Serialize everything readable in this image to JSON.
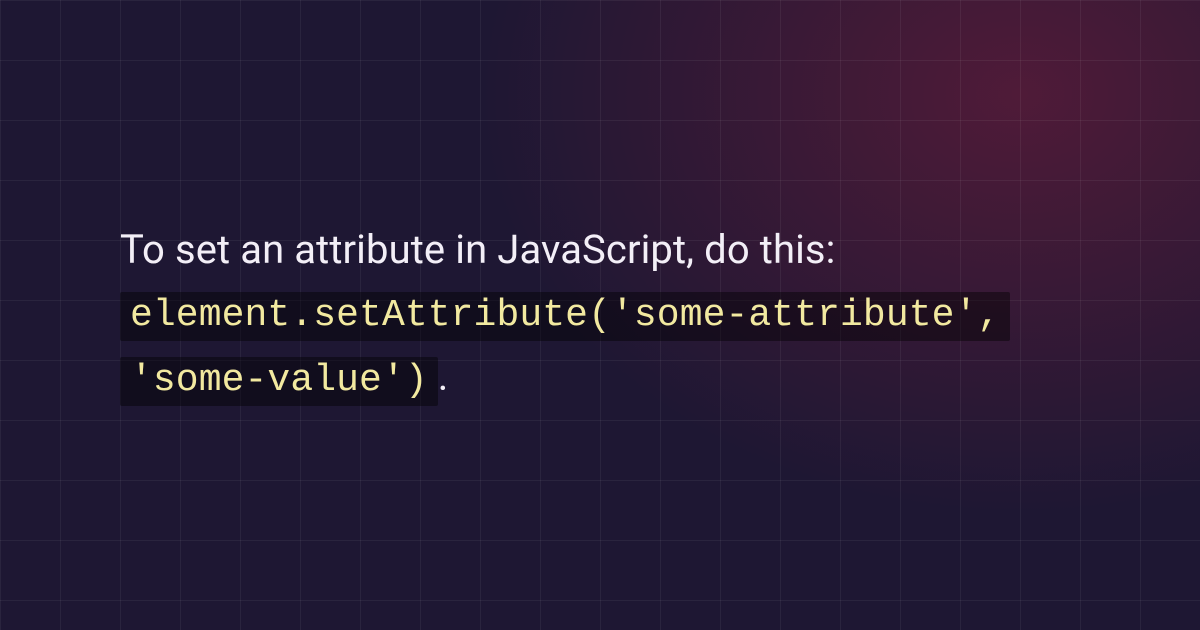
{
  "intro_text": "To set an attribute in JavaScript, do this:",
  "code_snippet": "element.setAttribute('some-attribute', 'some-value')",
  "trailing_text": "."
}
